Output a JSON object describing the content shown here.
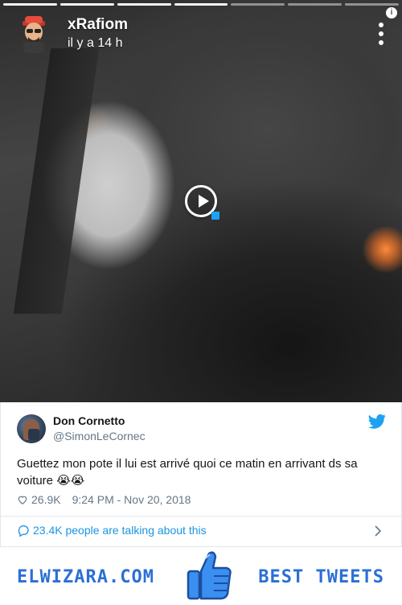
{
  "snap": {
    "username": "xRafiom",
    "timestamp": "il y a 14 h",
    "progress_segments": 7,
    "progress_done": 4
  },
  "tweet": {
    "author_name": "Don Cornetto",
    "author_handle": "@SimonLeCornec",
    "text": "Guettez mon pote il lui est arrivé quoi ce matin en arrivant ds sa voiture 😭😭",
    "likes": "26.9K",
    "datetime": "9:24 PM - Nov 20, 2018",
    "talking": "23.4K people are talking about this"
  },
  "banner": {
    "site": "ELWIZARA.COM",
    "tagline": "BEST TWEETS"
  },
  "colors": {
    "twitter_blue": "#1da1f2",
    "link_blue": "#1b95e0",
    "banner_blue": "#2b6fd6",
    "muted_text": "#657786"
  },
  "icons": [
    "info-icon",
    "more-options-icon",
    "play-icon",
    "twitter-bird-icon",
    "heart-icon",
    "speech-bubble-icon",
    "chevron-right-icon",
    "thumbs-up-icon"
  ]
}
